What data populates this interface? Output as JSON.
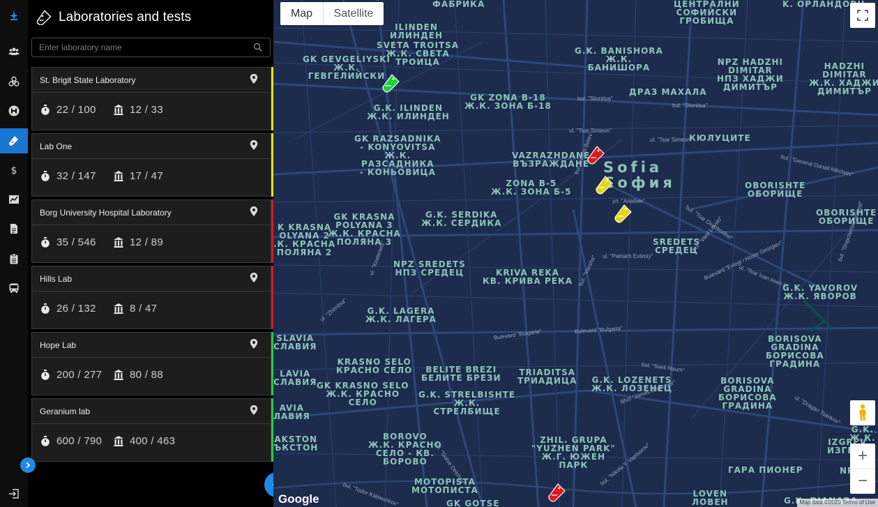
{
  "panel": {
    "title": "Laboratories and tests",
    "search_placeholder": "Enter laboratory name",
    "add_label": "+"
  },
  "rail": {
    "items": [
      {
        "icon": "logo-icon",
        "active": false
      },
      {
        "icon": "people-icon",
        "active": false
      },
      {
        "icon": "biohazard-icon",
        "active": false
      },
      {
        "icon": "hospital-icon",
        "active": false
      },
      {
        "icon": "test-tube-icon",
        "active": true
      },
      {
        "icon": "dollar-icon",
        "active": false
      },
      {
        "icon": "chart-icon",
        "active": false
      },
      {
        "icon": "document-icon",
        "active": false
      },
      {
        "icon": "clipboard-icon",
        "active": false
      },
      {
        "icon": "bus-icon",
        "active": false
      },
      {
        "icon": "logout-icon",
        "active": false
      }
    ]
  },
  "labs": [
    {
      "name": "St. Brigit State Laboratory",
      "tests": "22 / 100",
      "beds": "12 / 33",
      "status_color": "#f5e100"
    },
    {
      "name": "Lab One",
      "tests": "32 / 147",
      "beds": "17 / 47",
      "status_color": "#f5e100"
    },
    {
      "name": "Borg University Hospital Laboratory",
      "tests": "35 / 546",
      "beds": "12 / 89",
      "status_color": "#e3171a"
    },
    {
      "name": "Hills Lab",
      "tests": "26 / 132",
      "beds": "8 / 47",
      "status_color": "#e3171a"
    },
    {
      "name": "Hope Lab",
      "tests": "200 / 277",
      "beds": "80 / 88",
      "status_color": "#19d33a"
    },
    {
      "name": "Geranium lab",
      "tests": "600 / 790",
      "beds": "400 / 463",
      "status_color": "#19d33a"
    }
  ],
  "map": {
    "type_map": "Map",
    "type_satellite": "Satellite",
    "google": "Google",
    "data": "Map data ©2020   Terms of Use",
    "zoom_in": "+",
    "zoom_out": "−",
    "places": [
      {
        "t": "ФАБРИКА"
      },
      {
        "t": "ILINDEN\nИЛИНДЕН"
      },
      {
        "t": "SVETA TROITSA\nЖ.К. СВЕТА\nТРОИЦА"
      },
      {
        "t": "G.K. BANISHORA\nЖ.К.\nБАНИШОРА"
      },
      {
        "t": "ЦЕНТРАЛНИ\nСОФИЙСКИ\nГРОБИЩА"
      },
      {
        "t": "K. ОРЛАНДОВЦ"
      },
      {
        "t": "GK GEVGELIYSKI\nЖ.К.\nГЕВГЕЛИЙСКИ"
      },
      {
        "t": "NPZ HADZHI\nDIMITAR\nНПЗ ХАДЖИ\nДИМИТЪР"
      },
      {
        "t": "HADZHI\nDIMITAR\nЖ.К. ХАДЖИ\nДИМИТЪР"
      },
      {
        "t": "GK ZONA B-18\nЖ.К. ЗОНА Б-18"
      },
      {
        "t": "ДРАЗ МАХАЛА"
      },
      {
        "t": "G.K. ILINDEN\nЖ.К. ИЛИНДЕН"
      },
      {
        "t": "КЮЛУЦИТЕ"
      },
      {
        "t": "GK RAZSADNIKA\n- KONYOVITSA\nЖ.К.\nРАЗСАДНИКА\n- КОНЬОВИЦА"
      },
      {
        "t": "VAZRAZHDANE\nВЪЗРАЖДАНЕ"
      },
      {
        "t": "Sofia\nСофия"
      },
      {
        "t": "ZONA B-5\nЖ.К. ЗОНА Б-5"
      },
      {
        "t": "OBORISHTE\nОБОРИЩЕ"
      },
      {
        "t": "OBORISHTE\nОБОРИЩЕ"
      },
      {
        "t": "GK KRASNA\nPOLYANA 3\nЖ.К. КРАСНА\nПОЛЯНА 3"
      },
      {
        "t": "K KRASNA\nOLYANA 2\n.К. КРАСНА\nПОЛЯНА 2"
      },
      {
        "t": "G.K. SERDIKA\nЖ.К. СЕРДИКА"
      },
      {
        "t": "SREDETS\nСРЕДЕЦ"
      },
      {
        "t": "NPZ SREDETS\nНПЗ СРЕДЕЦ"
      },
      {
        "t": "KRIVA REKA\nКВ. КРИВА РЕКА"
      },
      {
        "t": "G.K. YAVOROV\nЖ.К. ЯВОРОВ"
      },
      {
        "t": "G.K. LAGERA\nЖ.К. ЛАГЕРА"
      },
      {
        "t": "SLAVIA\nСЛАВИЯ"
      },
      {
        "t": "BORISOVA\nGRADINA\nБОРИСОВА\nГРАДИНА"
      },
      {
        "t": "KRASNO SELO\nКРАСНО СЕЛО"
      },
      {
        "t": "BELITE BREZI\nБЕЛИТЕ БРЕЗИ"
      },
      {
        "t": "TRIADITSA\nТРИАДИЦА"
      },
      {
        "t": "LAVIA\nСЛАВИЯ"
      },
      {
        "t": "G.K. LOZENETS\nЖ.К. ЛОЗЕНЕЦ"
      },
      {
        "t": "BORISOVA\nGRADINA\nБОРИСОВА\nГРАДИНА"
      },
      {
        "t": "GK KRASNO SELO\nЖ.К. КРАСНО\nСЕЛО"
      },
      {
        "t": "G.K. STRELBISHTE\nЖ.К.\nСТРЕЛБИЩЕ"
      },
      {
        "t": "AVIA\nЛАВИЯ"
      },
      {
        "t": "AKSTON\nЪКСТОН"
      },
      {
        "t": "BOROVO\nЖ.К. КРАСНО\nСЕЛО - КВ.\nБОРОВО"
      },
      {
        "t": "ZHIL. GRUPA\n\"YUZHEN PARK\"\nЖ.Г. ЮЖЕН\nПАРК"
      },
      {
        "t": "IZGREV\nИЗГРЕВ"
      },
      {
        "t": "G.K.\nЖ.К."
      },
      {
        "t": "ГАРА ПИОНЕР"
      },
      {
        "t": "NPZ"
      },
      {
        "t": "MOTOPISTA\nМОТОПИСТА"
      },
      {
        "t": "GK GOTSE"
      },
      {
        "t": "LOVEN\nЛОВЕН"
      },
      {
        "t": "G.K. DIANABA"
      }
    ],
    "streets": [
      {
        "t": "bul. \"Slivnitsa\""
      },
      {
        "t": "bul. \"Slivnitsa\""
      },
      {
        "t": "ul. \"Tsar Simeon\""
      },
      {
        "t": "ul. \"Tsar Simeon\""
      },
      {
        "t": "bul. \"General Danail Nikolaev\""
      },
      {
        "t": "bul. \"Hristo Botev\""
      },
      {
        "t": "ул. \"Алабин\""
      },
      {
        "t": "bul. \"Tsar Osvoboditel\""
      },
      {
        "t": "bul. \"Vasil Levski\""
      },
      {
        "t": "ul. \"Patriarh Evtimiy\""
      },
      {
        "t": "Bulevard \"Evlogi i Hristo Georgiev\""
      },
      {
        "t": "ul. \"Tsar Ivan Asen II\""
      },
      {
        "t": "bul. \"Vitosha\""
      },
      {
        "t": "Bulevard \"Bulgaria\""
      },
      {
        "t": "Bulevard \"Bulgaria\""
      },
      {
        "t": "bul. \"Sveti Naum\""
      },
      {
        "t": "Blvd \"James Bourchier\""
      },
      {
        "t": "ul. \"Dragan Tsankov\""
      },
      {
        "t": "ul. \"Zhitnitsa\""
      },
      {
        "t": "ul. \"Kostenets\""
      },
      {
        "t": "bul. \"Gotse Delchev\""
      },
      {
        "t": "bul. \"Todor Kableshkov\""
      },
      {
        "t": "bul. \"Nikola Y. Vaptsarov\""
      },
      {
        "t": "bul. \"Shipchenski prohod\""
      }
    ],
    "markers": [
      {
        "color": "#19d33a"
      },
      {
        "color": "#e3171a"
      },
      {
        "color": "#e6d414"
      },
      {
        "color": "#e6d414"
      },
      {
        "color": "#e3171a"
      }
    ]
  }
}
